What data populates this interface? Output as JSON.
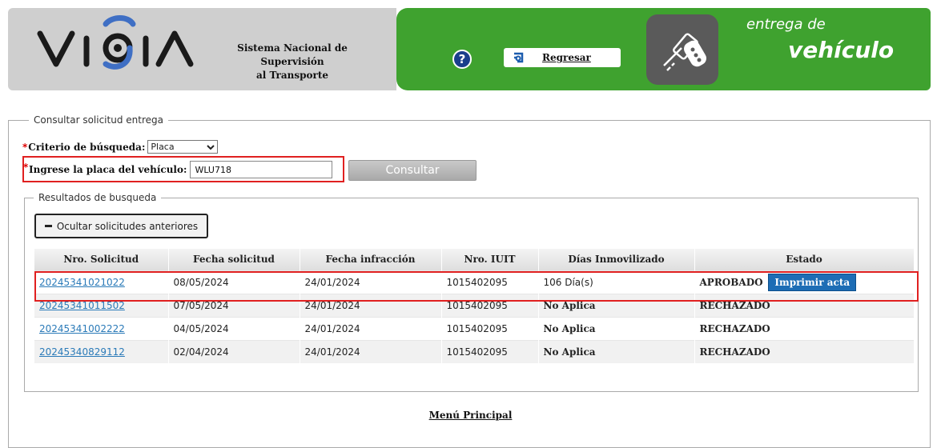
{
  "header": {
    "logo_text": "VIGIA",
    "system_title": [
      "Sistema Nacional de",
      "Supervisión",
      "al Transporte"
    ],
    "help_icon": "question-circle-icon",
    "back_button_label": "Regresar",
    "module_title_line1": "entrega de",
    "module_title_line2": "vehículo",
    "colors": {
      "left_bg": "#cfcfcf",
      "right_bg": "#3fa22f",
      "keys_bg": "#5a5a5a"
    }
  },
  "search": {
    "legend": "Consultar solicitud entrega",
    "criteria_label": "Criterio de búsqueda:",
    "criteria_value": "Placa",
    "plate_label": "Ingrese la placa del vehículo:",
    "plate_value": "WLU718",
    "consult_button": "Consultar",
    "required_mark": "*"
  },
  "results": {
    "legend": "Resultados de busqueda",
    "toggle_button": "Ocultar solicitudes anteriores",
    "columns": [
      "Nro. Solicitud",
      "Fecha solicitud",
      "Fecha infracción",
      "Nro. IUIT",
      "Días Inmovilizado",
      "Estado"
    ],
    "rows": [
      {
        "solicitud": "20245341021022",
        "fecha_solicitud": "08/05/2024",
        "fecha_infraccion": "24/01/2024",
        "iuit": "1015402095",
        "dias": "106 Día(s)",
        "estado": "APROBADO",
        "action": "Imprimir acta"
      },
      {
        "solicitud": "20245341011502",
        "fecha_solicitud": "07/05/2024",
        "fecha_infraccion": "24/01/2024",
        "iuit": "1015402095",
        "dias": "No Aplica",
        "estado": "RECHAZADO"
      },
      {
        "solicitud": "20245341002222",
        "fecha_solicitud": "04/05/2024",
        "fecha_infraccion": "24/01/2024",
        "iuit": "1015402095",
        "dias": "No Aplica",
        "estado": "RECHAZADO"
      },
      {
        "solicitud": "20245340829112",
        "fecha_solicitud": "02/04/2024",
        "fecha_infraccion": "24/01/2024",
        "iuit": "1015402095",
        "dias": "No Aplica",
        "estado": "RECHAZADO"
      }
    ]
  },
  "footer": {
    "menu_link": "Menú Principal"
  }
}
